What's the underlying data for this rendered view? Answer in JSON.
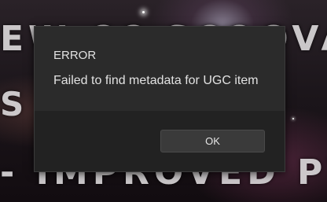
{
  "background": {
    "line1": "EW CC SCQOVA",
    "line2": "S T    S —",
    "line3": "- IMPROVED PVE -"
  },
  "dialog": {
    "title": "ERROR",
    "message": "Failed to find metadata for UGC item",
    "ok_label": "OK"
  },
  "colors": {
    "dialog_bg": "#2b2b2b",
    "dialog_footer_bg": "#222222",
    "button_bg": "#3a3a3a",
    "text": "#e2e2e2"
  }
}
